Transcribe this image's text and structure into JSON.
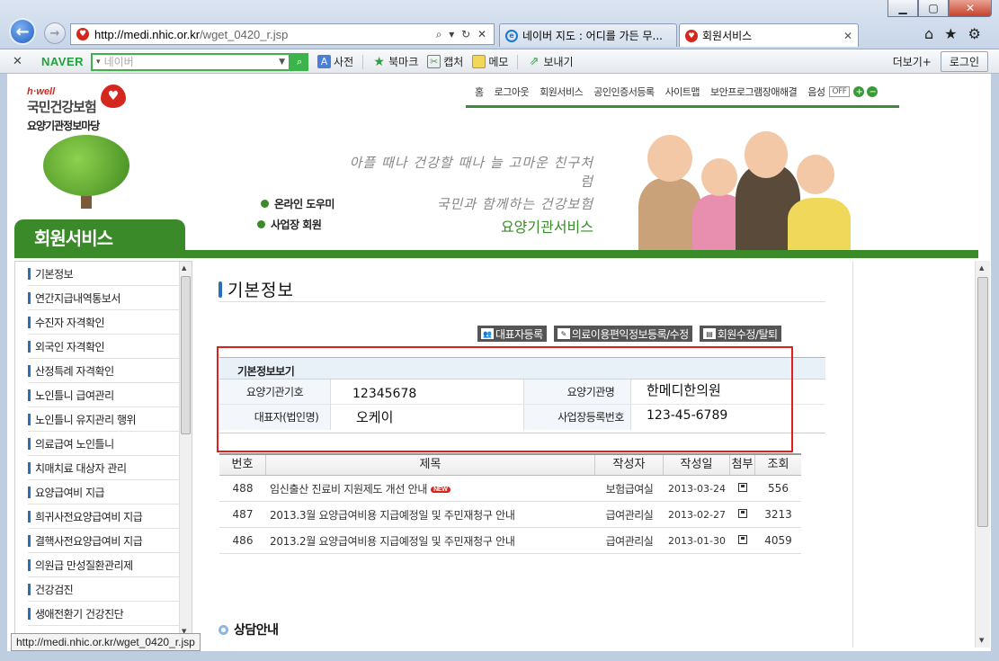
{
  "browser": {
    "url_host": "http://medi.nhic.or.kr",
    "url_path": "/wget_0420_r.jsp",
    "addr_controls": "⌕ ▾ ↻ ✕",
    "tabs": [
      {
        "label": "네이버 지도 : 어디를 가든 무..."
      },
      {
        "label": "회원서비스"
      }
    ],
    "status_url": "http://medi.nhic.or.kr/wget_0420_r.jsp"
  },
  "naver": {
    "brand": "NAVER",
    "search_placeholder": "네이버",
    "items": [
      "사전",
      "북마크",
      "캡처",
      "메모",
      "보내기"
    ],
    "more": "더보기+",
    "login": "로그인"
  },
  "header": {
    "logo_small": "h·well",
    "logo_name": "국민건강보험",
    "logo_sub": "요양기관정보마당",
    "top_nav": [
      "홈",
      "로그아웃",
      "회원서비스",
      "공인인증서등록",
      "사이트맵",
      "보안프로그램장애해결",
      "음성"
    ],
    "voice_state": "OFF",
    "side_links": [
      "온라인 도우미",
      "사업장 회원"
    ],
    "slogan_1": "아플 때나 건강할 때나 늘 고마운 친구처럼",
    "slogan_2": "국민과 함께하는 건강보험",
    "slogan_3": "요양기관서비스",
    "banner": "회원서비스"
  },
  "left_menu": [
    "기본정보",
    "연간지급내역통보서",
    "수진자 자격확인",
    "외국인 자격확인",
    "산정특례 자격확인",
    "노인틀니 급여관리",
    "노인틀니 유지관리 행위",
    "의료급여 노인틀니",
    "치매치료 대상자 관리",
    "요양급여비 지급",
    "희귀사전요양급여비 지급",
    "결핵사전요양급여비 지급",
    "의원급 만성질환관리제",
    "건강검진",
    "생애전환기 건강진단"
  ],
  "main": {
    "title": "기본정보",
    "buttons": [
      "대표자등록",
      "의료이용편익정보등록/수정",
      "회원수정/탈퇴"
    ],
    "info_title": "기본정보보기",
    "info": {
      "code_label": "요양기관기호",
      "code_value": "12345678",
      "name_label": "요양기관명",
      "name_value": "한메디한의원",
      "rep_label": "대표자(법인명)",
      "rep_value": "오케이",
      "biz_label": "사업장등록번호",
      "biz_value": "123-45-6789"
    },
    "board_headers": [
      "번호",
      "제목",
      "작성자",
      "작성일",
      "첨부",
      "조회"
    ],
    "board_rows": [
      {
        "no": "488",
        "title": "임신출산 진료비 지원제도 개선 안내",
        "badge": "NEW",
        "author": "보험급여실",
        "date": "2013-03-24",
        "views": "556"
      },
      {
        "no": "487",
        "title": "2013.3월 요양급여비용 지급예정일 및 주민재청구 안내",
        "badge": "",
        "author": "급여관리실",
        "date": "2013-02-27",
        "views": "3213"
      },
      {
        "no": "486",
        "title": "2013.2월 요양급여비용 지급예정일 및 주민재청구 안내",
        "badge": "",
        "author": "급여관리실",
        "date": "2013-01-30",
        "views": "4059"
      }
    ],
    "consult": "상담안내"
  }
}
